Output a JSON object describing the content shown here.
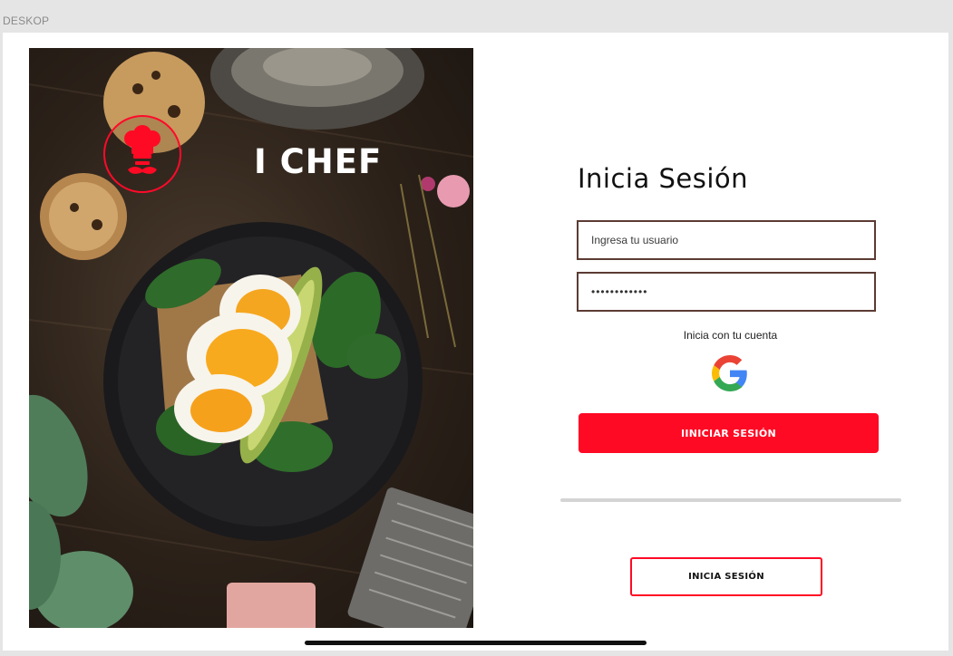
{
  "frame": {
    "label": "DESKOP"
  },
  "brand": {
    "title": "I CHEF",
    "logo_icon": "chef-hat-mustache-icon",
    "accent_color": "#ff0a24"
  },
  "login": {
    "title": "Inicia Sesión",
    "username": {
      "placeholder": "Ingresa tu usuario",
      "value": ""
    },
    "password": {
      "value": "••••••••••••"
    },
    "google_caption": "Inicia con tu cuenta",
    "google_icon": "google-g-icon",
    "primary_button": "IINICIAR SESIÓN",
    "secondary_button": "INICIA SESIÓN"
  },
  "colors": {
    "primary": "#ff0a24",
    "field_border": "#5b3b33",
    "divider": "#d4d4d4"
  }
}
